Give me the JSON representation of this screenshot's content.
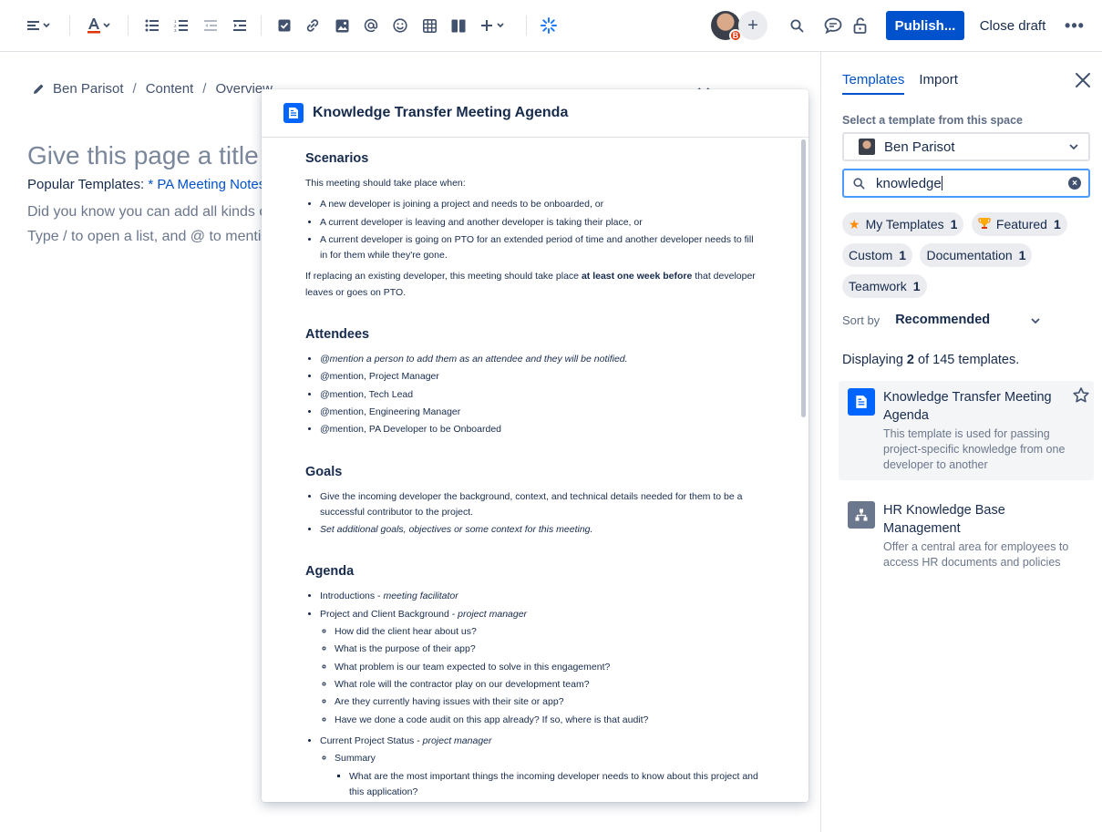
{
  "toolbar": {
    "publish_label": "Publish...",
    "close_draft_label": "Close draft",
    "avatar_badge": "B",
    "more_label": "•••"
  },
  "editor": {
    "breadcrumbs": [
      "Ben Parisot",
      "Content",
      "Overview"
    ],
    "title_placeholder": "Give this page a title",
    "popular_prefix": "Popular Templates:",
    "popular_link": "* PA Meeting Notes",
    "hint_line1": "Did you know you can add all kinds o",
    "hint_line2": "Type / to open a list, and @ to menti"
  },
  "preview": {
    "title": "Knowledge Transfer Meeting Agenda",
    "scenarios_heading": "Scenarios",
    "scenarios_intro": "This meeting should take place when:",
    "scenarios": [
      "A new developer is joining a project and needs to be onboarded, or",
      "A current developer is leaving and another developer is taking their place, or",
      "A current developer is going on PTO for an extended period of time and another developer needs to fill in for them while they're gone."
    ],
    "replace_pre": "If replacing an existing developer, this meeting should take place ",
    "replace_bold": "at least one week before",
    "replace_post": " that developer leaves or goes on PTO.",
    "attendees_heading": "Attendees",
    "attendees_italic": "@mention a person to add them as an attendee and they will be notified.",
    "attendees": [
      "@mention, Project Manager",
      "@mention, Tech Lead",
      "@mention, Engineering Manager",
      "@mention, PA Developer to be Onboarded"
    ],
    "goals_heading": "Goals",
    "goals_1": "Give the incoming developer the background, context, and technical details needed for them to be a successful contributor to the project.",
    "goals_2": "Set additional goals, objectives or some context for this meeting.",
    "agenda_heading": "Agenda",
    "agenda_intro": "Introductions - ",
    "agenda_intro_role": "meeting facilitator",
    "agenda_background": "Project and Client Background - ",
    "agenda_background_role": "project manager",
    "agenda_background_items": [
      "How did the client hear about us?",
      "What is the purpose of their app?",
      "What problem is our team expected to solve in this engagement?",
      "What role will the contractor play on our development team?",
      "Are they currently having issues with their site or app?",
      "Have we done a code audit on this app already? If so, where is that audit?"
    ],
    "agenda_status": "Current Project Status - ",
    "agenda_status_role": "project manager",
    "agenda_summary": "Summary",
    "agenda_summary_item": "What are the most important things the incoming developer needs to know about this project and this application?"
  },
  "panel": {
    "tabs": [
      "Templates",
      "Import"
    ],
    "select_label": "Select a template from this space",
    "space_name": "Ben Parisot",
    "search_value": "knowledge",
    "chips": [
      {
        "label": "My Templates",
        "count": "1",
        "icon": "star-icon"
      },
      {
        "label": "Featured",
        "count": "1",
        "icon": "trophy-icon"
      },
      {
        "label": "Custom",
        "count": "1"
      },
      {
        "label": "Documentation",
        "count": "1"
      },
      {
        "label": "Teamwork",
        "count": "1"
      }
    ],
    "sort_label": "Sort by",
    "sort_value": "Recommended",
    "displaying_pre": "Displaying ",
    "displaying_count": "2",
    "displaying_post": " of 145 templates.",
    "results": [
      {
        "title": "Knowledge Transfer Meeting Agenda",
        "desc": "This template is used for passing project-specific knowledge from one developer to another",
        "color": "#0065ff"
      },
      {
        "title": "HR Knowledge Base Management",
        "desc": "Offer a central area for employees to access HR documents and policies",
        "color": "#6b778c"
      }
    ]
  }
}
